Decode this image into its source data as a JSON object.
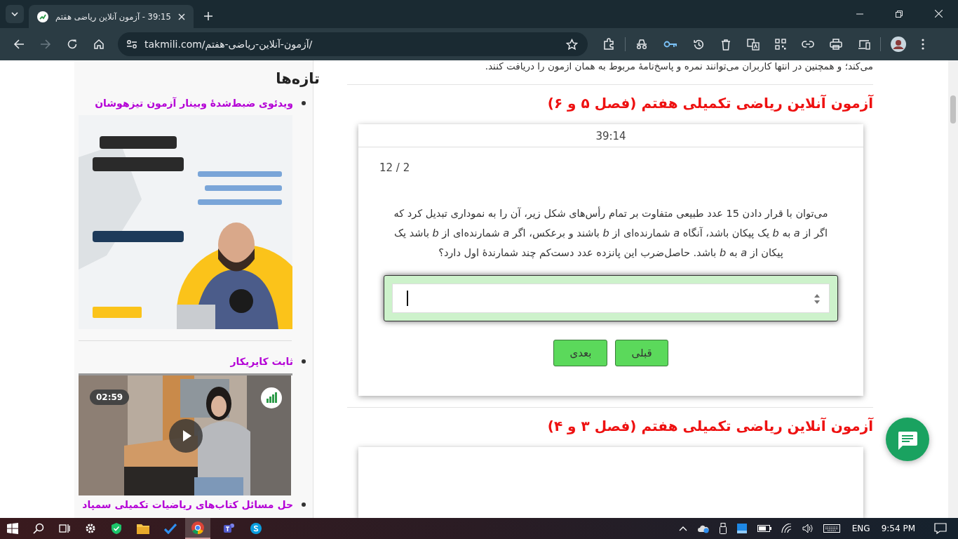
{
  "browser": {
    "tab": {
      "title": "39:15 - آزمون آنلاین ریاضی هفتم",
      "selected": true
    },
    "address": "takmili.com/آزمون-آنلاین-ریاضی-هفتم/"
  },
  "page": {
    "intro": "می‌کند؛ و همچنین در انتها کاربران می‌توانند نمره و پاسخ‌نامهٔ مربوط به همان ازمون را دریافت کنند.",
    "sidebar": {
      "heading": "تازه‌ها",
      "items": [
        {
          "kind": "banner",
          "title": "ویدئوی ضبط‌شدهٔ وبینار آزمون تیزهوشان"
        },
        {
          "kind": "video",
          "title": "ثابت کاپریکار",
          "duration": "02:59"
        },
        {
          "kind": "link",
          "title": "حل مسائل کتاب‌های ریاضیات تکمیلی سمپاد"
        }
      ]
    },
    "quizzes": [
      {
        "kind": "active",
        "title": "آزمون آنلاین ریاضی تکمیلی هفتم (فصل ۵ و ۶)",
        "timer": "39:14",
        "progress": "12 / 2",
        "question": "می‌توان با قرار دادن 15 عدد طبیعی متفاوت بر تمام رأس‌های شکل زیر، آن را به نموداری تبدیل کرد که اگر از *a* به *b* یک پیکان باشد، آنگاه *a* شمارنده‌ای از *b* باشند و برعکس، اگر *a* شمارنده‌ای از *b* باشد یک پیکان از *a* به *b* باشد. حاصل‌ضرب این پانزده عدد دست‌کم چند شمارندهٔ اول دارد؟",
        "buttons": [
          "قبلی",
          "بعدی"
        ]
      },
      {
        "kind": "collapsed",
        "title": "آزمون آنلاین ریاضی تکمیلی هفتم (فصل ۳ و ۴)"
      }
    ]
  },
  "taskbar": {
    "language": "ENG",
    "time": "9:54 PM"
  }
}
